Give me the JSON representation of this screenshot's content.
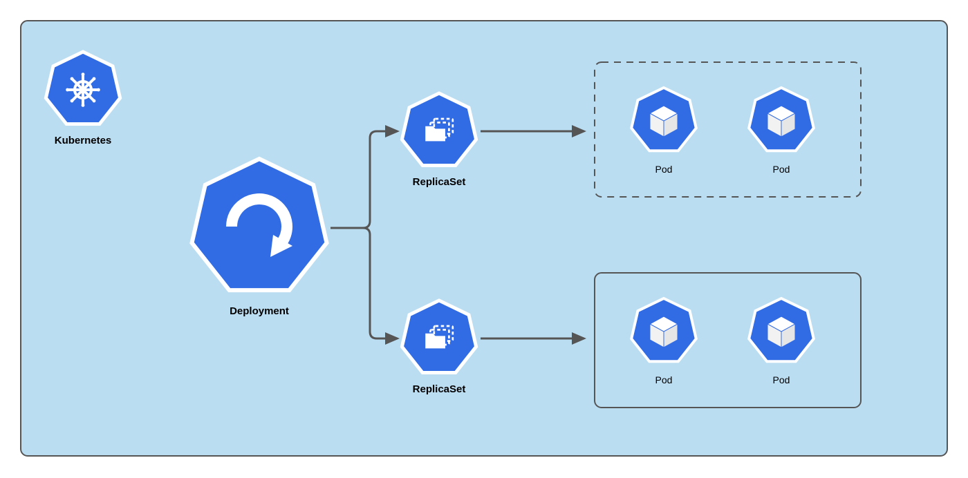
{
  "logo": {
    "label": "Kubernetes"
  },
  "deployment": {
    "label": "Deployment"
  },
  "replicasets": [
    {
      "label": "ReplicaSet"
    },
    {
      "label": "ReplicaSet"
    }
  ],
  "podGroups": [
    {
      "border": "dashed",
      "pods": [
        {
          "label": "Pod"
        },
        {
          "label": "Pod"
        }
      ]
    },
    {
      "border": "solid",
      "pods": [
        {
          "label": "Pod"
        },
        {
          "label": "Pod"
        }
      ]
    }
  ],
  "colors": {
    "canvas": "#bbddf2",
    "shape": "#326ce5",
    "outline": "#ffffff",
    "arrow": "#555555",
    "frame": "#555555"
  }
}
